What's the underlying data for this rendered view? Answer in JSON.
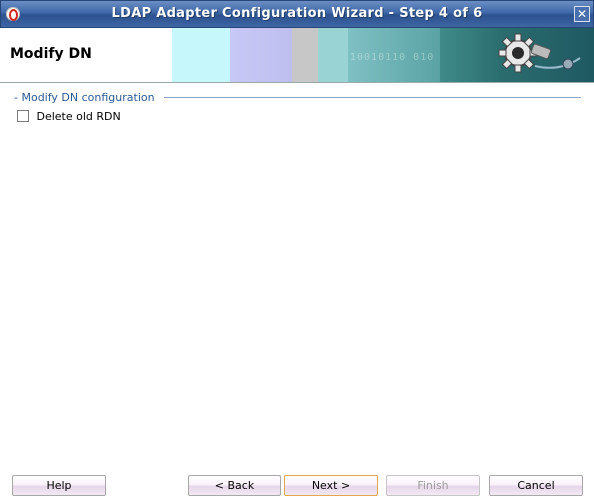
{
  "window": {
    "title": "LDAP Adapter Configuration Wizard - Step 4 of 6",
    "close_glyph": "✕"
  },
  "banner": {
    "title": "Modify DN",
    "watermark": "10010110 010"
  },
  "section": {
    "title": "Modify DN configuration",
    "checkbox_label": "Delete old RDN",
    "checkbox_checked": false
  },
  "buttons": {
    "help": "Help",
    "back": "< Back",
    "next": "Next >",
    "finish": "Finish",
    "cancel": "Cancel"
  },
  "colors": {
    "titlebar": "#3f68a8",
    "section_text": "#2c5a92",
    "focus_border": "#e5a54d"
  }
}
